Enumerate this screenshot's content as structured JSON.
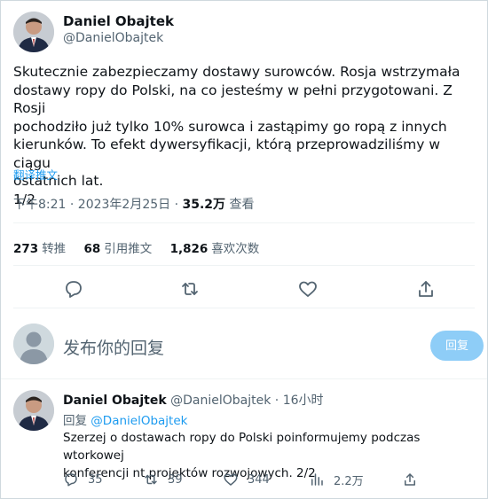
{
  "tweet": {
    "author_name": "Daniel Obajtek",
    "author_handle": "@DanielObajtek",
    "text_lines": [
      "Skutecznie zabezpieczamy dostawy surowców. Rosja wstrzymała",
      "dostawy ropy do Polski, na co jesteśmy w pełni przygotowani. Z Rosji",
      "pochodziło już tylko 10% surowca i zastąpimy go ropą z innych",
      "kierunków. To efekt dywersyfikacji, którą przeprowadziliśmy w ciągu",
      "ostatnich lat.",
      "1/2"
    ],
    "translate_label": "翻译推文",
    "time": "下午8:21 · 2023年2月25日 · ",
    "views_count": "35.2万",
    "views_label": " 查看"
  },
  "stats": {
    "retweets_count": "273",
    "retweets_label": "转推",
    "quotes_count": "68",
    "quotes_label": "引用推文",
    "likes_count": "1,826",
    "likes_label": "喜欢次数"
  },
  "actions": [
    "reply-icon",
    "retweet-icon",
    "like-icon",
    "share-icon"
  ],
  "compose": {
    "placeholder": "发布你的回复",
    "button_label": "回复"
  },
  "reply_tweet": {
    "author_name": "Daniel Obajtek",
    "author_handle": "@DanielObajtek",
    "time": "· 16小时",
    "reply_prefix": "回复 ",
    "reply_to": "@DanielObajtek",
    "text_lines": [
      "Szerzej o dostawach ropy do Polski poinformujemy podczas wtorkowej",
      "konferencji nt projektów rozwojowych. 2/2"
    ],
    "replies": "35",
    "retweets": "39",
    "likes": "344",
    "views": "2.2万"
  },
  "colors": {
    "accent": "#1d9bf0",
    "reply_button": "#8ecdf7",
    "text": "#0f1419",
    "muted": "#536471"
  }
}
